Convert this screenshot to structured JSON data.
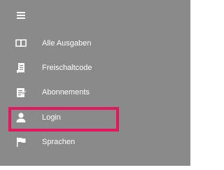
{
  "menu": {
    "items": [
      {
        "label": "Alle Ausgaben",
        "icon": "book-icon"
      },
      {
        "label": "Freischaltcode",
        "icon": "receipt-icon"
      },
      {
        "label": "Abonnements",
        "icon": "subscription-icon"
      },
      {
        "label": "Login",
        "icon": "user-icon"
      },
      {
        "label": "Sprachen",
        "icon": "flag-icon"
      }
    ]
  },
  "colors": {
    "background": "#8a8a8a",
    "text": "#ffffff",
    "highlight": "#e0195f"
  }
}
